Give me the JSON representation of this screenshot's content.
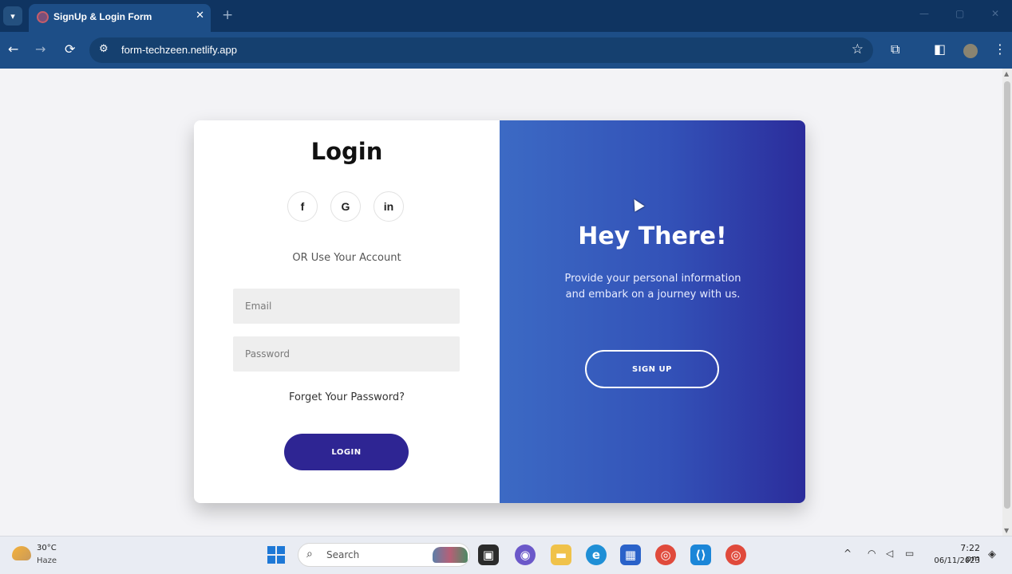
{
  "browser": {
    "tab_title": "SignUp & Login Form",
    "tab_close": "✕",
    "new_tab": "+",
    "url": "form-techzeen.netlify.app",
    "window_controls": {
      "minimize": "—",
      "maximize": "▢",
      "close": "✕"
    }
  },
  "login": {
    "title": "Login",
    "social": [
      {
        "label": "f",
        "icon": "facebook-icon"
      },
      {
        "label": "G",
        "icon": "google-icon"
      },
      {
        "label": "in",
        "icon": "linkedin-icon"
      }
    ],
    "or_text": "OR Use Your Account",
    "email_placeholder": "Email",
    "password_placeholder": "Password",
    "forgot": "Forget Your Password?",
    "button": "LOGIN"
  },
  "panel": {
    "heading": "Hey There!",
    "text": "Provide your personal information and embark on a journey with us.",
    "button": "SIGN UP"
  },
  "taskbar": {
    "temperature": "30°C",
    "condition": "Haze",
    "search_label": "Search",
    "time": "7:22 pm",
    "date": "06/11/2023"
  },
  "colors": {
    "browser_frame": "#0f3461",
    "toolbar": "#1d4e87",
    "login_button": "#2e2593",
    "panel_gradient_start": "#3c6ac4",
    "panel_gradient_end": "#2b2c9b"
  }
}
